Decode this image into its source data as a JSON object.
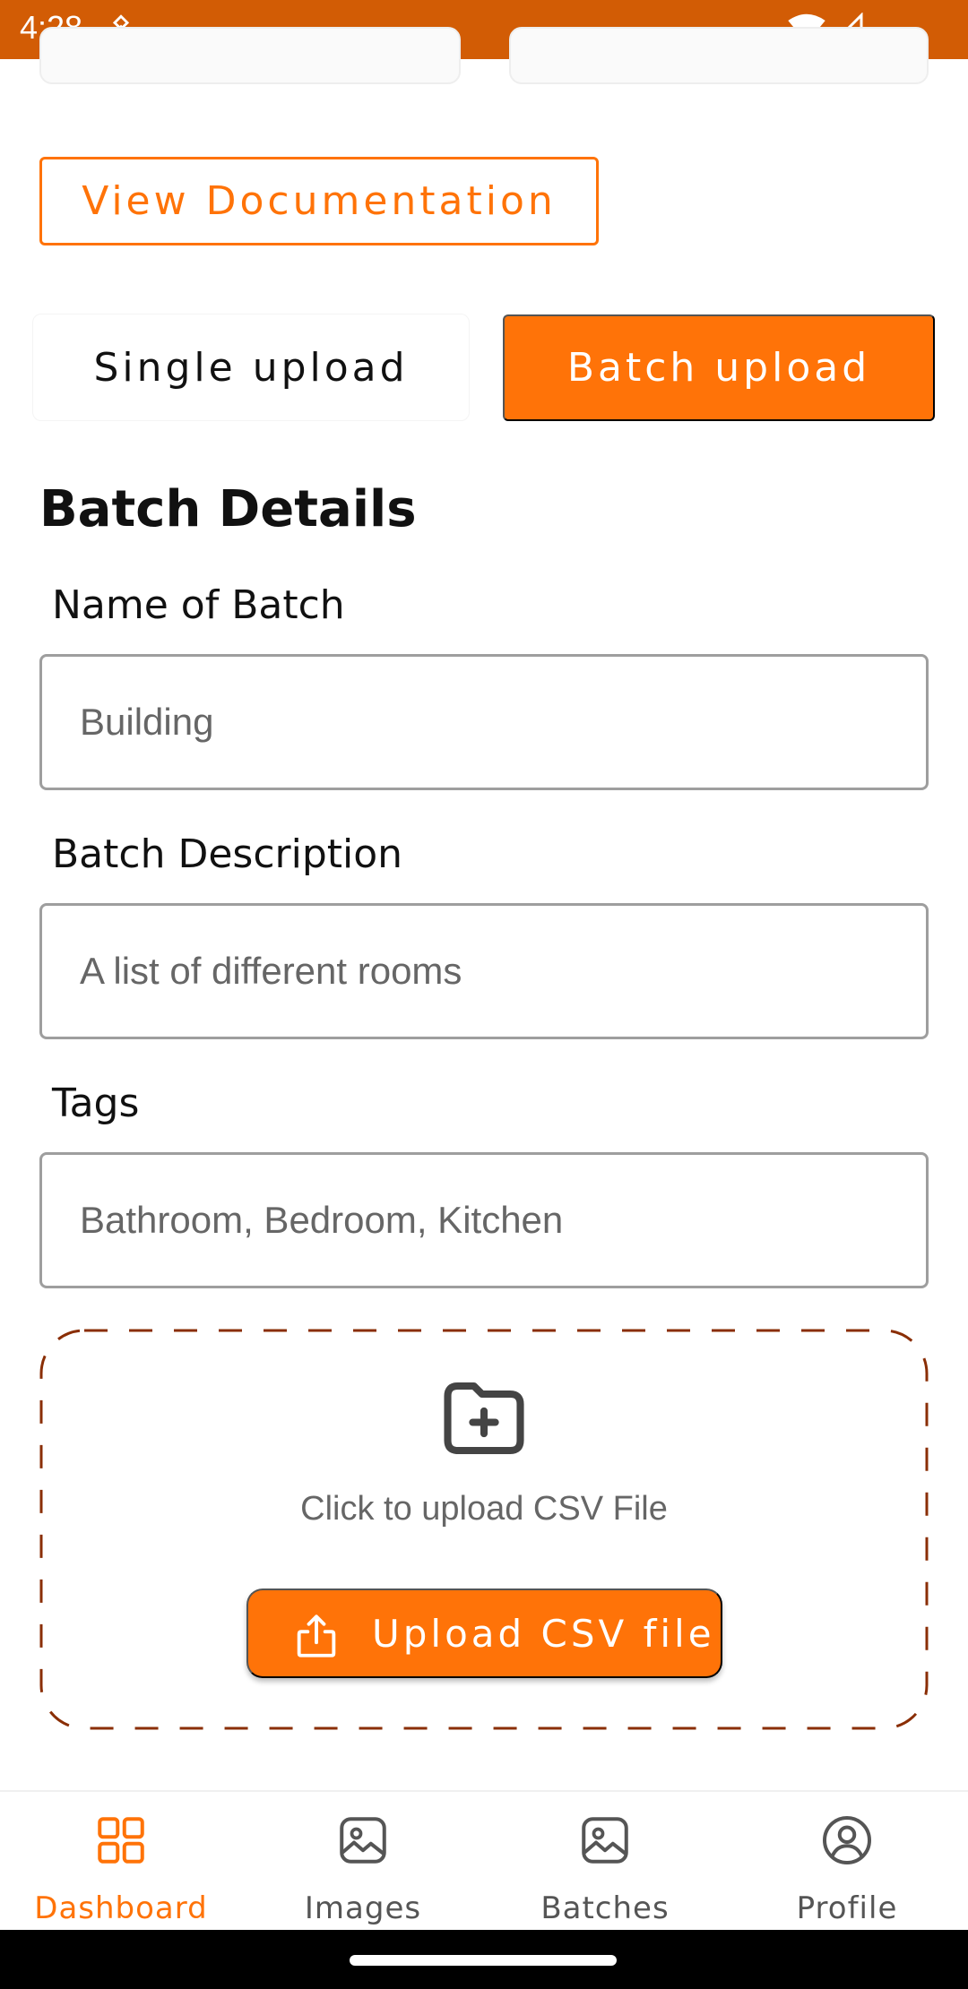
{
  "status_bar": {
    "time": "4:28"
  },
  "documentation": {
    "label": "View Documentation"
  },
  "upload_mode": {
    "single_label": "Single upload",
    "batch_label": "Batch upload",
    "selected": "batch"
  },
  "batch_details": {
    "title": "Batch Details",
    "name": {
      "label": "Name of Batch",
      "placeholder": "Building"
    },
    "description": {
      "label": "Batch Description",
      "placeholder": "A list of different rooms"
    },
    "tags": {
      "label": "Tags",
      "placeholder": "Bathroom, Bedroom, Kitchen"
    }
  },
  "upload": {
    "prompt": "Click to upload CSV File",
    "button_label": "Upload CSV file"
  },
  "bottom_nav": {
    "items": [
      {
        "label": "Dashboard",
        "icon": "grid-icon",
        "active": true
      },
      {
        "label": "Images",
        "icon": "image-icon",
        "active": false
      },
      {
        "label": "Batches",
        "icon": "image-icon",
        "active": false
      },
      {
        "label": "Profile",
        "icon": "user-circle-icon",
        "active": false
      }
    ]
  },
  "colors": {
    "accent": "#ff7308",
    "status_bar": "#d25c05",
    "dashed_border": "#8a2e05"
  }
}
